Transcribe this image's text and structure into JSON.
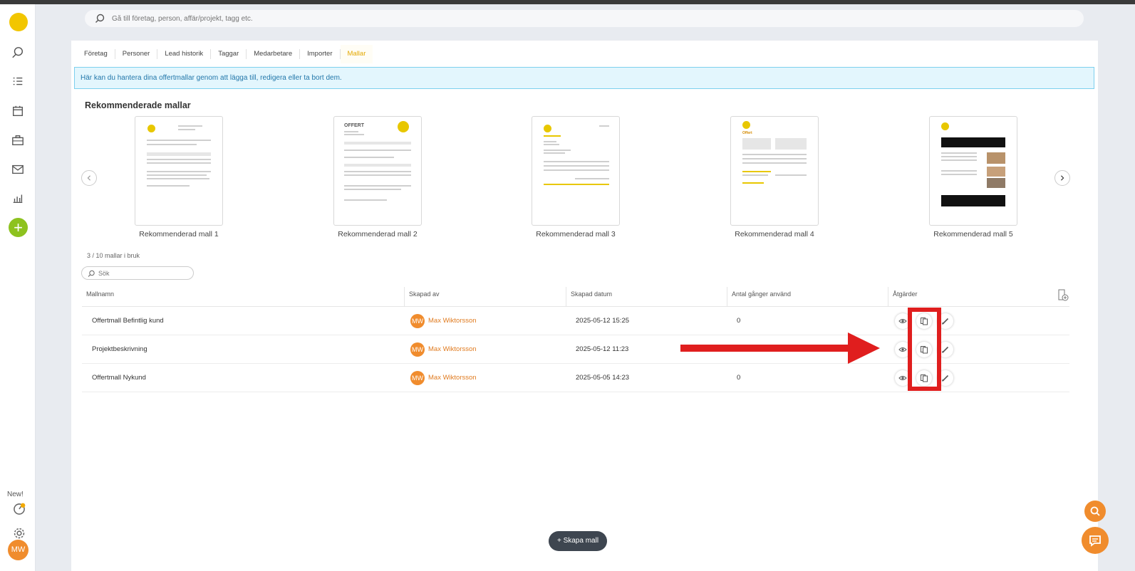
{
  "global_search": {
    "placeholder": "Gå till företag, person, affär/projekt, tagg etc."
  },
  "sidebar": {
    "new_label": "New!",
    "user_initials": "MW",
    "icons": [
      "search-icon",
      "list-icon",
      "calendar-icon",
      "briefcase-icon",
      "mail-icon",
      "chart-icon",
      "add-icon",
      "whats-new-icon",
      "gear-icon"
    ]
  },
  "tabs": [
    {
      "label": "Företag",
      "active": false
    },
    {
      "label": "Personer",
      "active": false
    },
    {
      "label": "Lead historik",
      "active": false
    },
    {
      "label": "Taggar",
      "active": false
    },
    {
      "label": "Medarbetare",
      "active": false
    },
    {
      "label": "Importer",
      "active": false
    },
    {
      "label": "Mallar",
      "active": true
    }
  ],
  "info_banner": "Här kan du hantera dina offertmallar genom att lägga till, redigera eller ta bort dem.",
  "recommended": {
    "title": "Rekommenderade mallar",
    "templates": [
      {
        "label": "Rekommenderad mall 1",
        "heading": ""
      },
      {
        "label": "Rekommenderad mall 2",
        "heading": "OFFERT"
      },
      {
        "label": "Rekommenderad mall 3",
        "heading": ""
      },
      {
        "label": "Rekommenderad mall 4",
        "heading": "Offert"
      },
      {
        "label": "Rekommenderad mall 5",
        "heading": ""
      }
    ]
  },
  "usage_text": "3 / 10 mallar i bruk",
  "table_search": {
    "placeholder": "Sök"
  },
  "table": {
    "headers": [
      "Mallnamn",
      "Skapad av",
      "Skapad datum",
      "Antal gånger använd",
      "Åtgärder"
    ],
    "rows": [
      {
        "name": "Offertmall Befintlig kund",
        "initials": "MW",
        "creator": "Max Wiktorsson",
        "date": "2025-05-12 15:25",
        "uses": "0"
      },
      {
        "name": "Projektbeskrivning",
        "initials": "MW",
        "creator": "Max Wiktorsson",
        "date": "2025-05-12 11:23",
        "uses": ""
      },
      {
        "name": "Offertmall Nykund",
        "initials": "MW",
        "creator": "Max Wiktorsson",
        "date": "2025-05-05 14:23",
        "uses": "0"
      }
    ]
  },
  "create_button": "+ Skapa mall",
  "colors": {
    "accent": "#e3a800",
    "brand_orange": "#f08c2d",
    "annotation_red": "#e01e1e",
    "add_green": "#8dc21f"
  }
}
